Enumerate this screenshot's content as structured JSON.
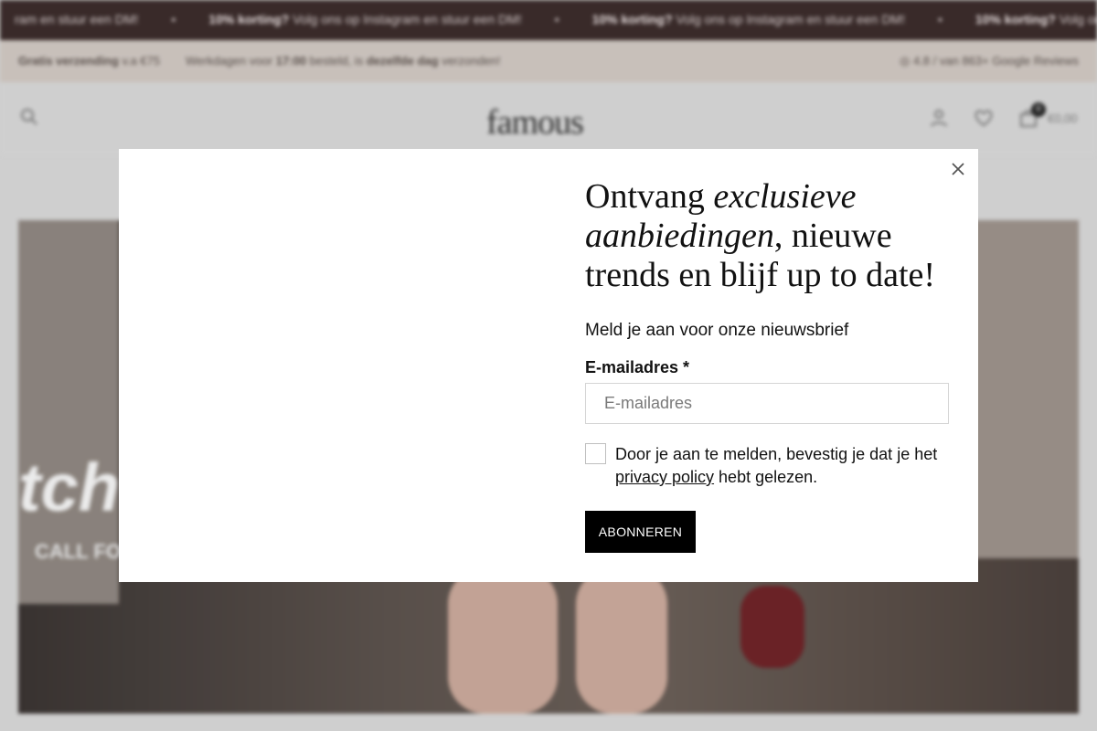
{
  "ticker": {
    "text_a": "Volg ons op Instagram en stuur een DM!",
    "bold_a": "10% korting?",
    "text_b": "Volg ons op Instagram en stuur een DM!",
    "lead": "ram en stuur een DM!"
  },
  "usp": {
    "shipping_bold": "Gratis verzending",
    "shipping_rest": "v.a €75",
    "delivery_pre": "Werkdagen voor",
    "delivery_time": "17:00",
    "delivery_mid": "besteld, is",
    "delivery_bold": "dezelfde dag",
    "delivery_post": "verzonden!",
    "reviews": "4.8 / van 863+ Google Reviews"
  },
  "header": {
    "logo": "famous",
    "cart_amount": "€0,00",
    "cart_count": "0",
    "icons": [
      "search-icon",
      "account-icon",
      "heart-icon",
      "bag-icon"
    ]
  },
  "hero": {
    "big_text": "tch",
    "small_text": "CALL FO"
  },
  "modal": {
    "headline_1": "Ontvang ",
    "headline_italic": "exclusieve aanbiedingen",
    "headline_2": ", nieuwe trends en blijf up to date!",
    "subtitle": "Meld je aan voor onze nieuwsbrief",
    "email_label": "E-mailadres *",
    "email_placeholder": "E-mailadres",
    "email_value": "",
    "consent_pre": "Door je aan te melden, bevestig je dat je het ",
    "consent_link": "privacy policy",
    "consent_post": " hebt gelezen.",
    "subscribe": "ABONNEREN",
    "close_icon": "close-icon"
  }
}
